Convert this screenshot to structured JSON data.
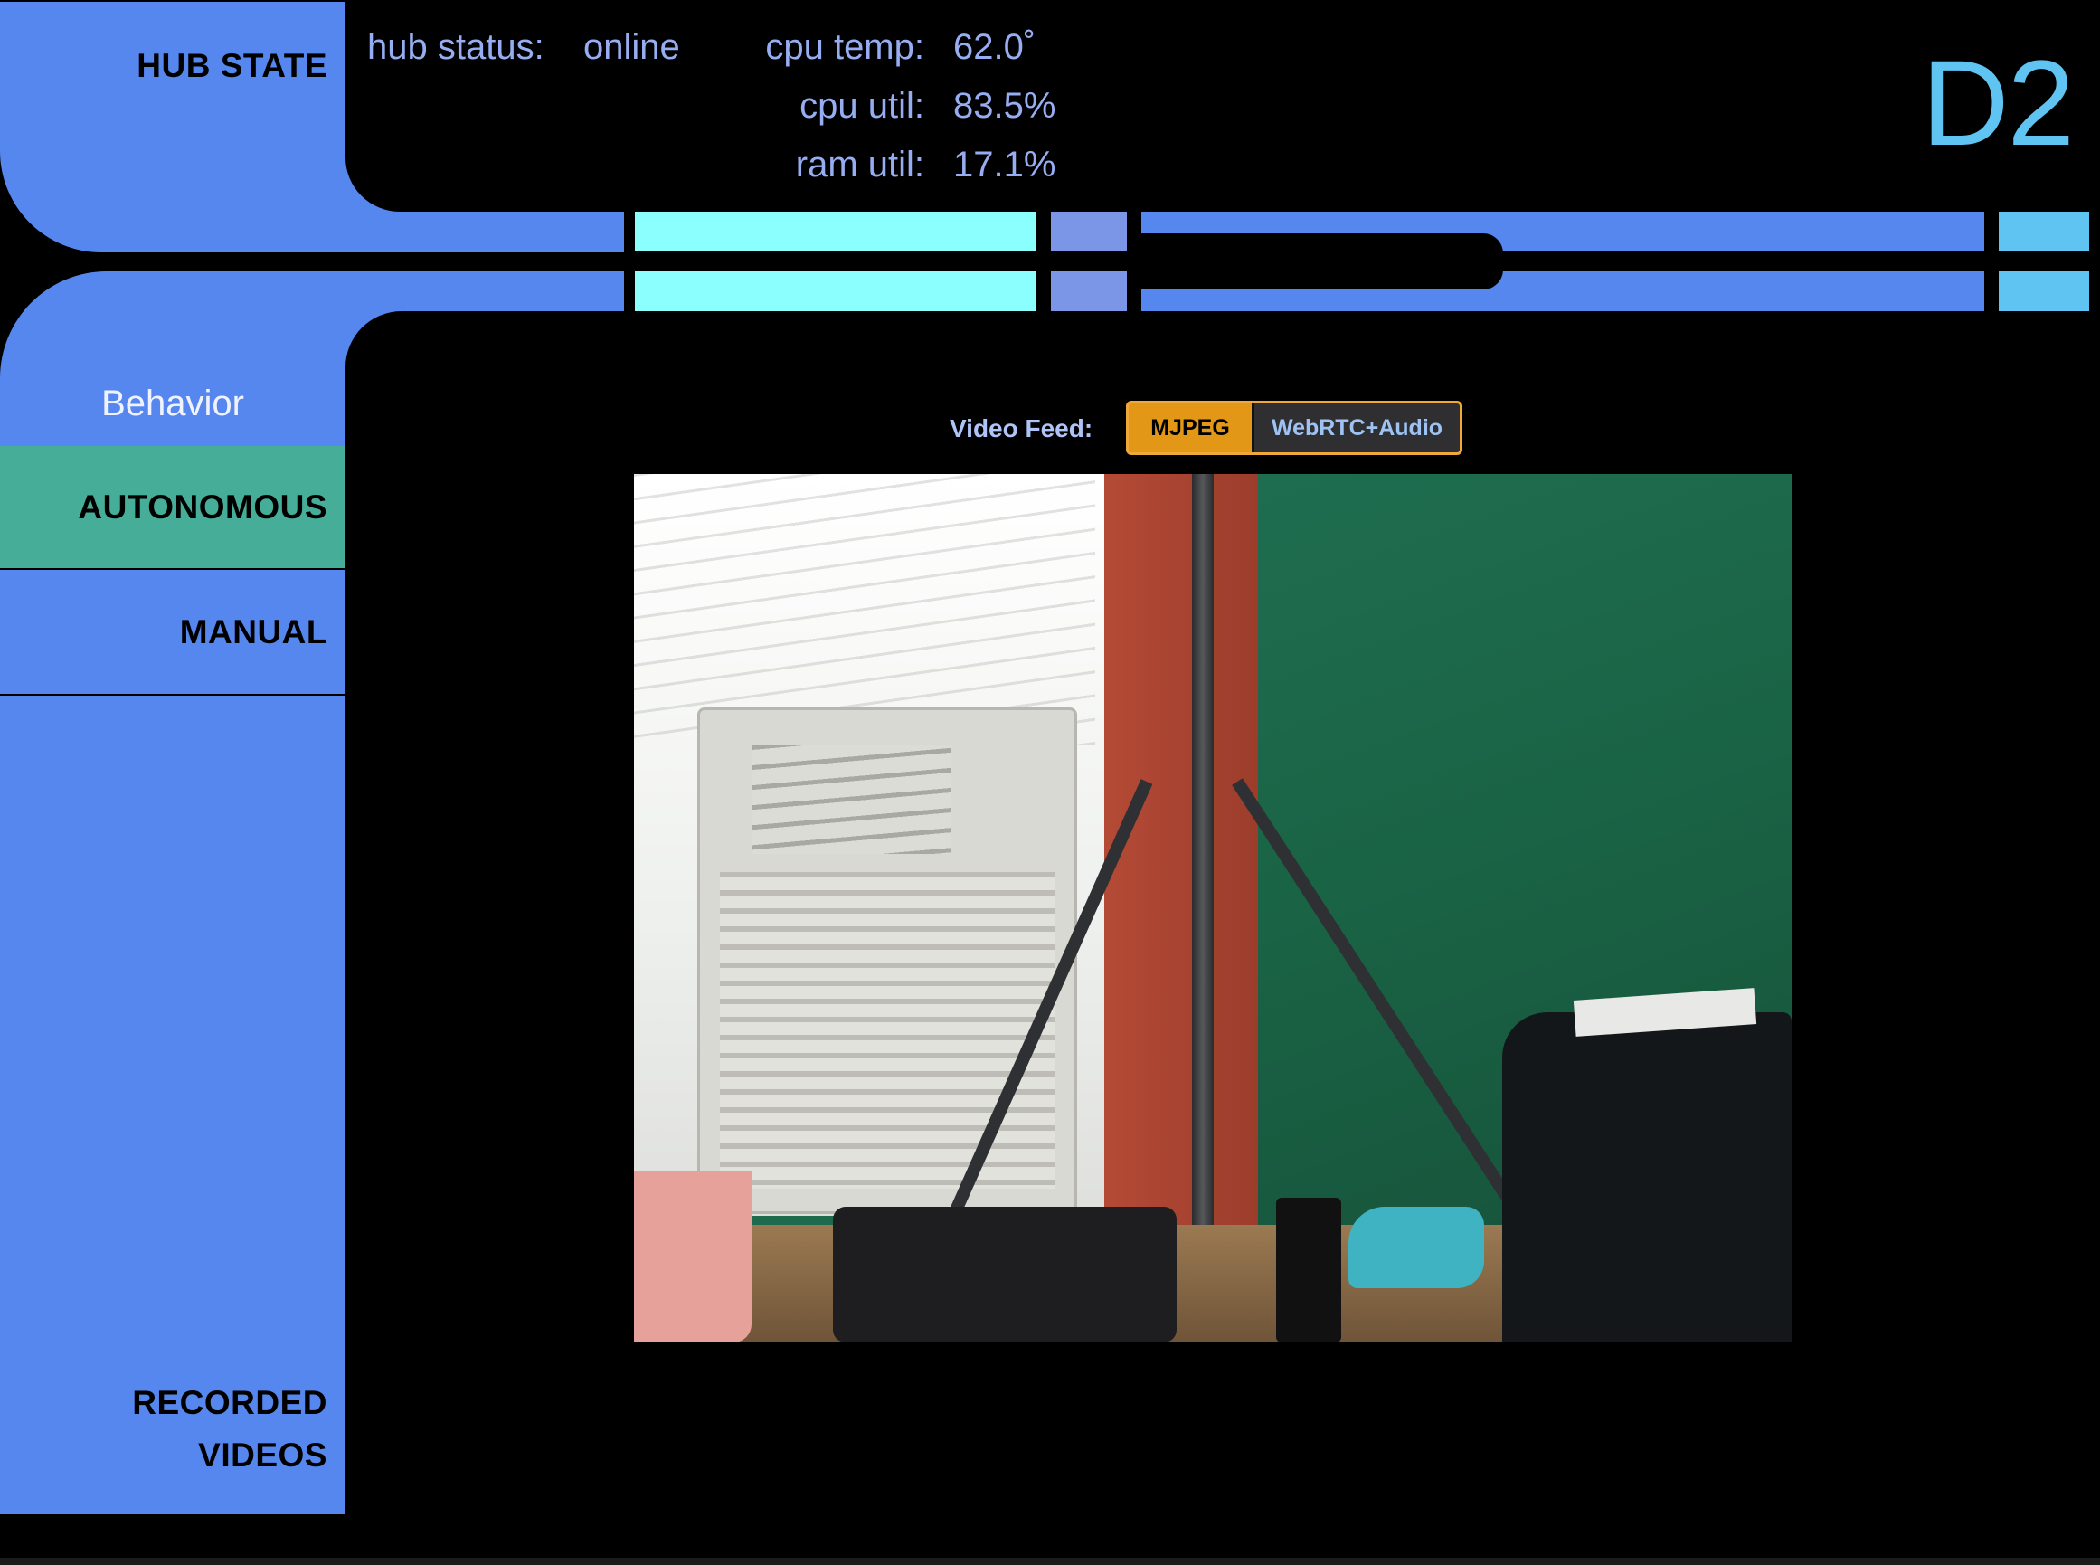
{
  "header": {
    "section_label": "HUB STATE",
    "device_name": "D2",
    "stats": [
      {
        "label": "hub status:",
        "value": "online"
      },
      {
        "label": "cpu temp:",
        "value": "62.0˚"
      },
      {
        "label": "cpu util:",
        "value": "83.5%"
      },
      {
        "label": "ram util:",
        "value": "17.1%"
      }
    ]
  },
  "sidebar": {
    "heading": "Behavior",
    "items": [
      {
        "label": "AUTONOMOUS",
        "active": true
      },
      {
        "label": "MANUAL",
        "active": false
      }
    ],
    "recorded": {
      "line1": "RECORDED",
      "line2": "VIDEOS"
    }
  },
  "video": {
    "label": "Video Feed:",
    "options": [
      {
        "label": "MJPEG",
        "selected": true
      },
      {
        "label": "WebRTC+Audio",
        "selected": false
      }
    ]
  },
  "colors": {
    "panel_blue": "#5687ef",
    "cyan": "#8bfffe",
    "sky": "#5fc4f2",
    "active_green": "#45ad98",
    "toggle_orange": "#e29716"
  }
}
